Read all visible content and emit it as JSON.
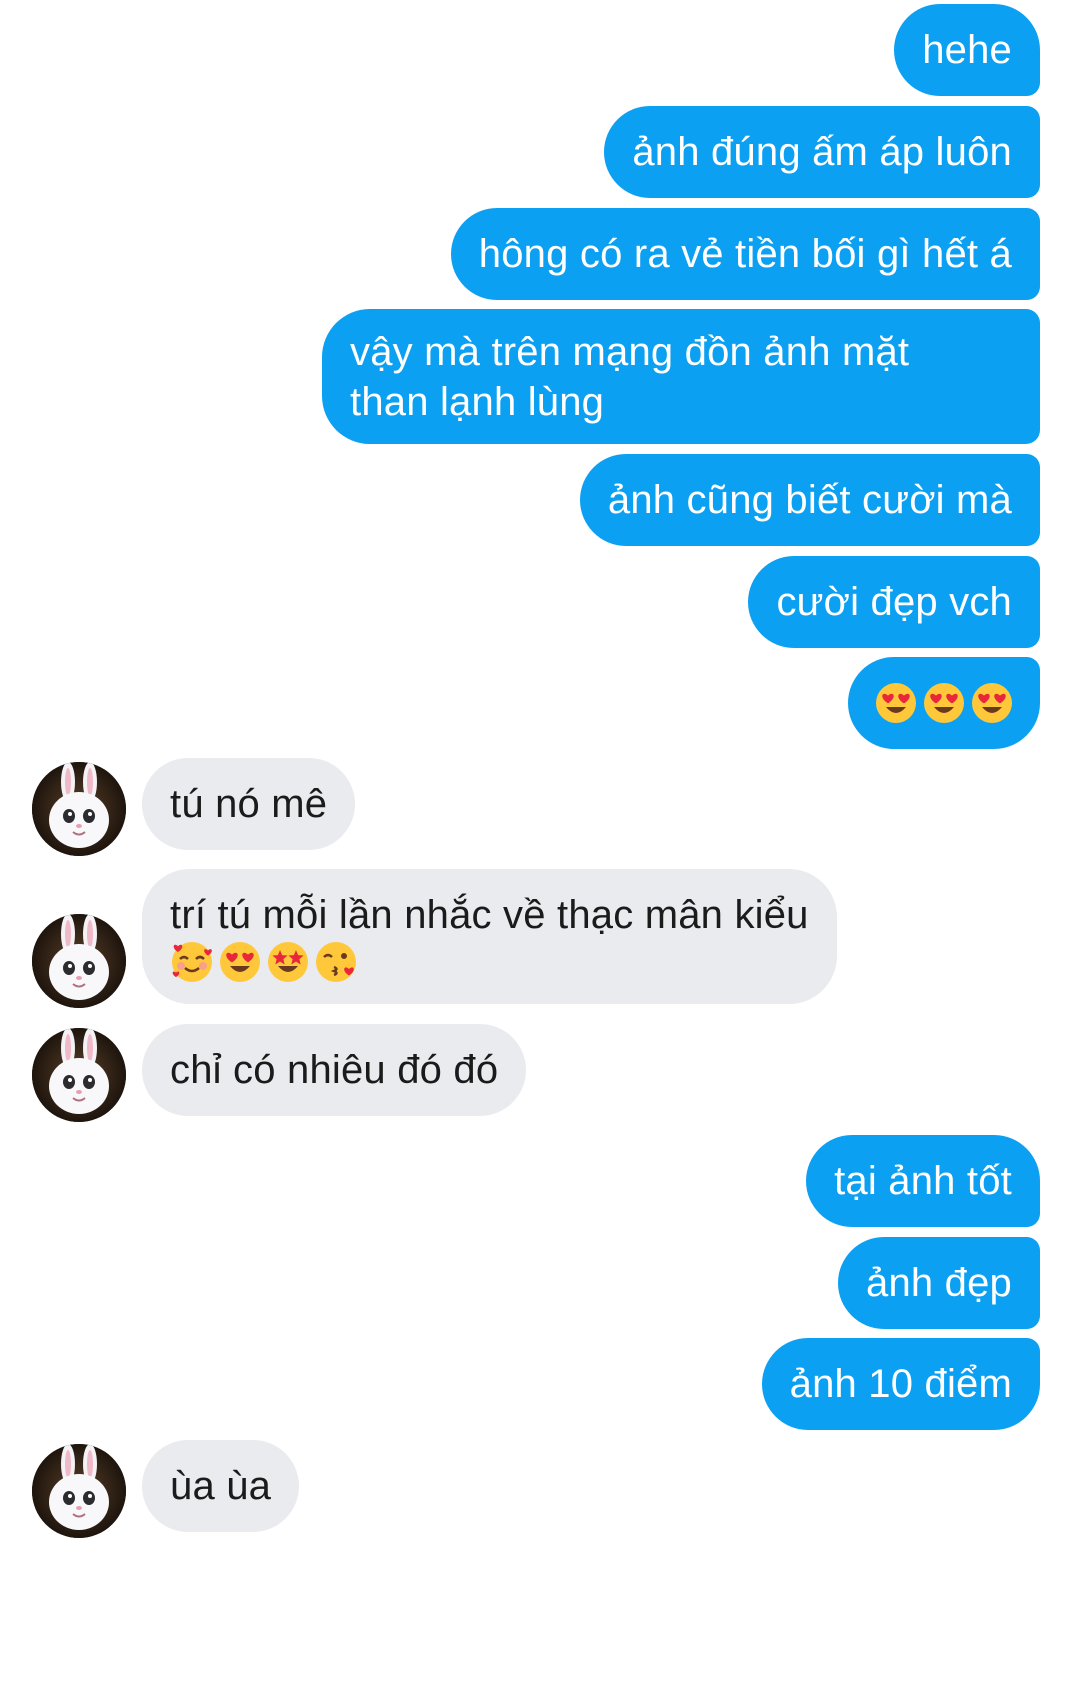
{
  "conversation": {
    "messages": [
      {
        "sender": "me",
        "text": "hehe"
      },
      {
        "sender": "me",
        "text": "ảnh đúng ấm áp luôn"
      },
      {
        "sender": "me",
        "text": "hông có ra vẻ tiền bối gì hết á"
      },
      {
        "sender": "me",
        "text": "vậy mà trên mạng đồn ảnh mặt\nthan lạnh lùng"
      },
      {
        "sender": "me",
        "text": "ảnh cũng biết cười mà"
      },
      {
        "sender": "me",
        "text": "cười đẹp vch"
      },
      {
        "sender": "me",
        "emojis": [
          "heart-eyes",
          "heart-eyes",
          "heart-eyes"
        ]
      },
      {
        "sender": "friend",
        "text": "tú nó mê"
      },
      {
        "sender": "friend",
        "text": "trí tú mỗi lần nhắc về thạc mân kiểu",
        "emojis": [
          "smiling-face-with-hearts",
          "heart-eyes",
          "star-struck",
          "face-blowing-kiss"
        ]
      },
      {
        "sender": "friend",
        "text": "chỉ có nhiêu đó đó"
      },
      {
        "sender": "me",
        "text": "tại ảnh tốt"
      },
      {
        "sender": "me",
        "text": "ảnh đẹp"
      },
      {
        "sender": "me",
        "text": "ảnh 10 điểm"
      },
      {
        "sender": "friend",
        "text": "ùa ùa"
      }
    ]
  },
  "colors": {
    "outgoing_bubble": "#0ca0f2",
    "incoming_bubble": "#e9ebef",
    "outgoing_text": "#ffffff",
    "incoming_text": "#1b1b1b"
  },
  "icons": {
    "avatar": "white-bunny-avatar-icon"
  }
}
